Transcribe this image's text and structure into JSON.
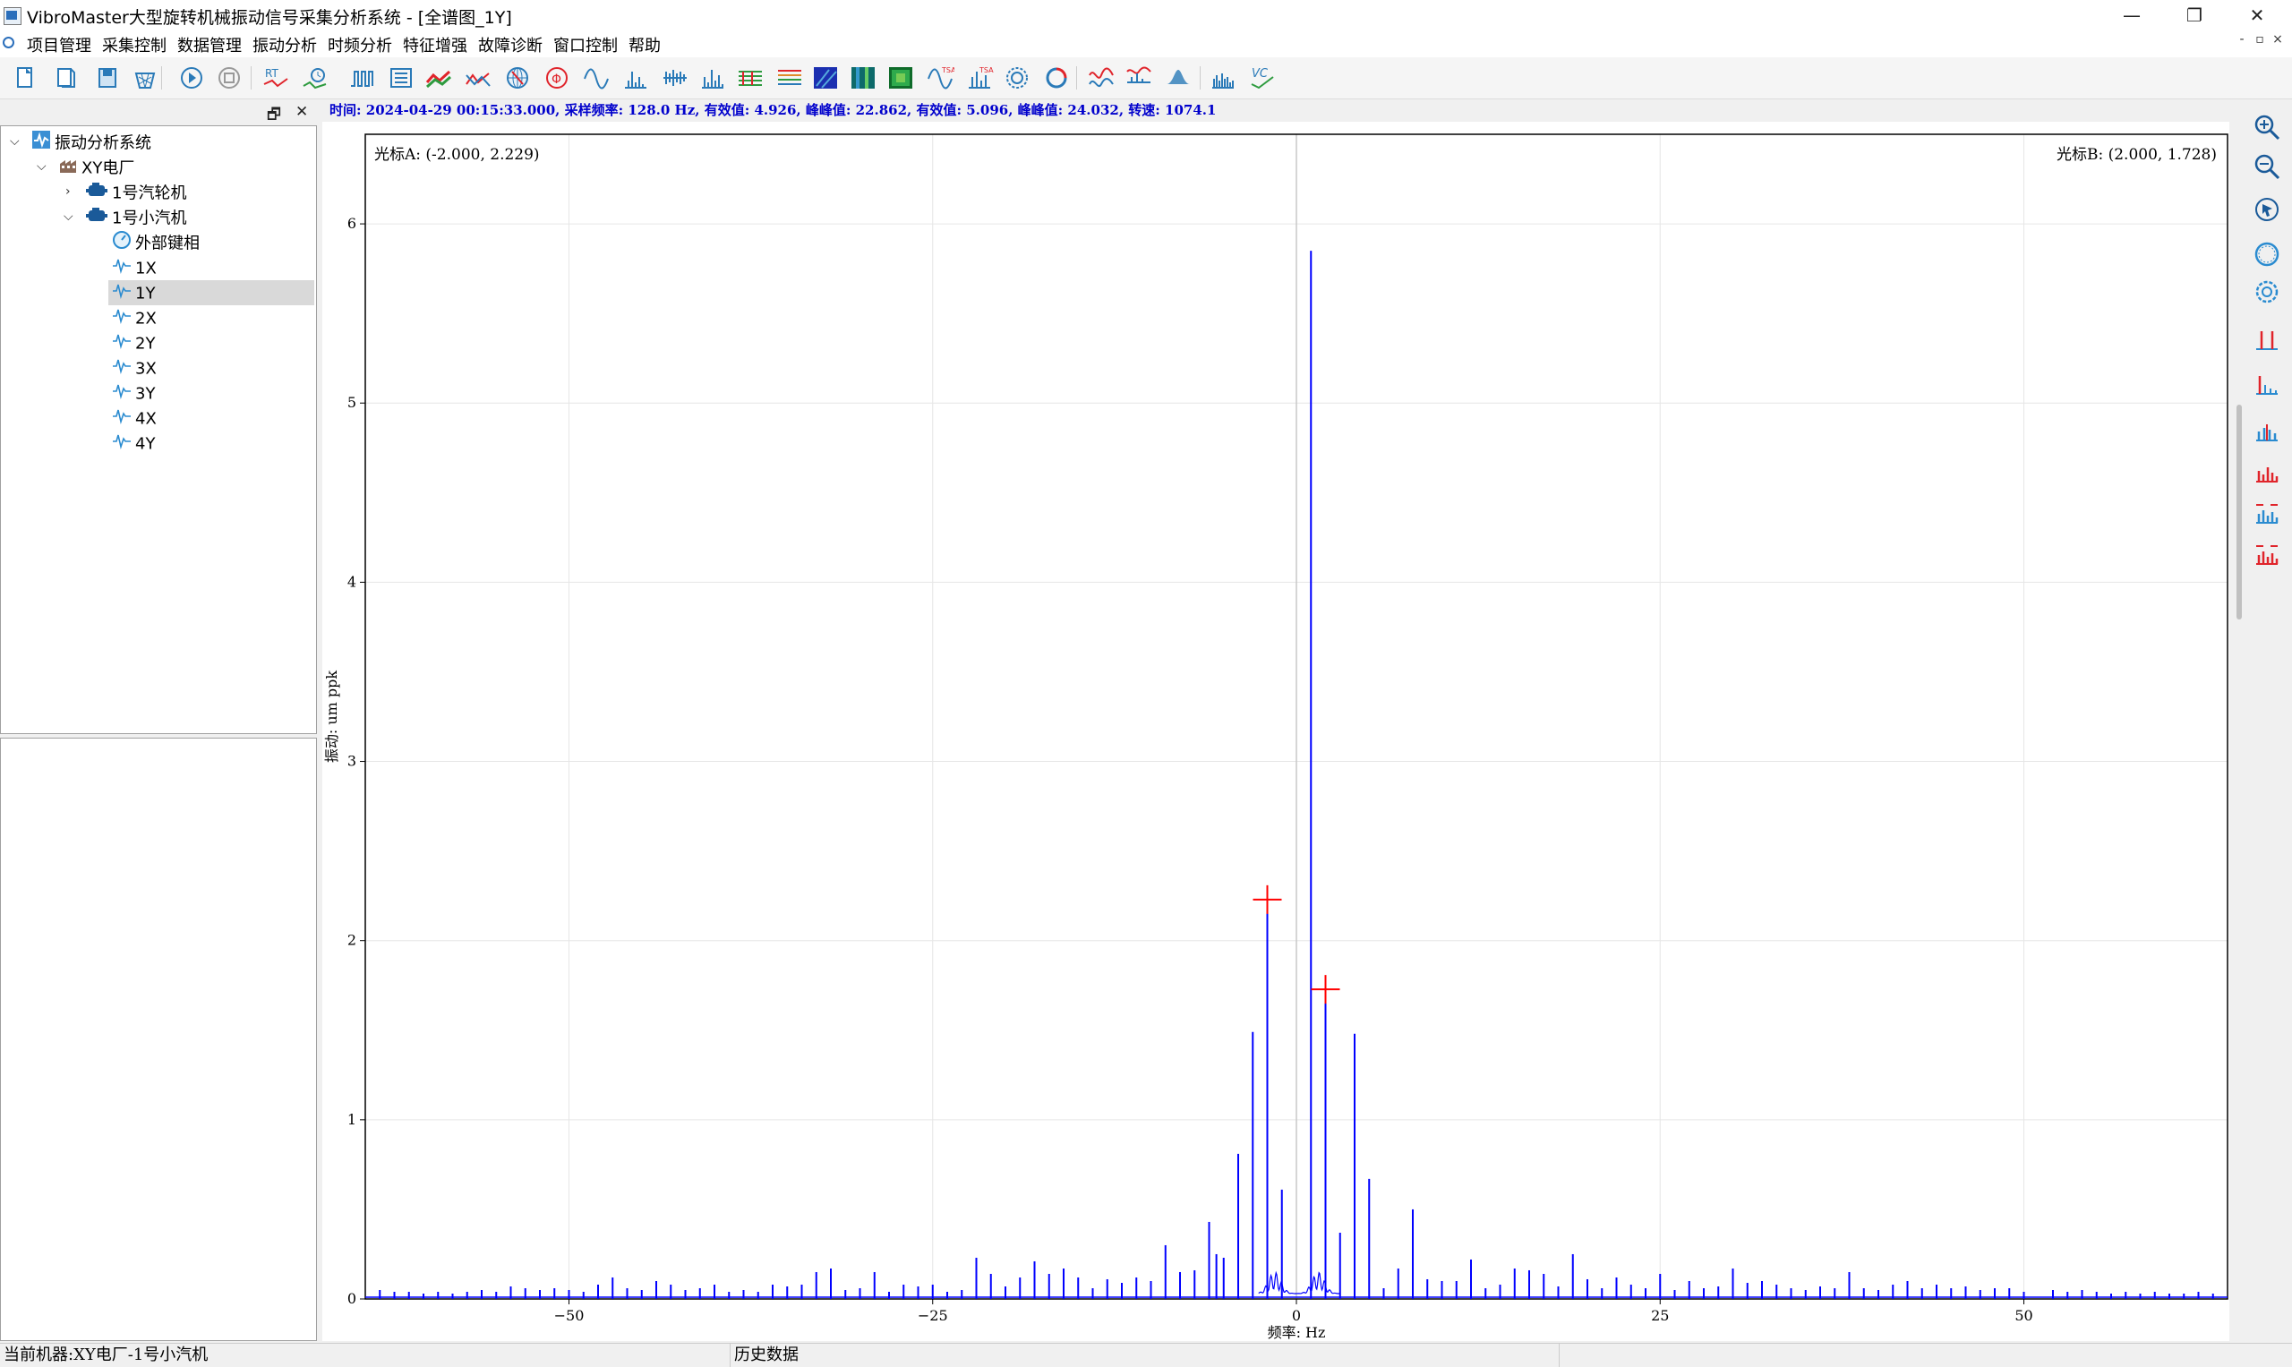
{
  "window": {
    "title": "VibroMaster大型旋转机械振动信号采集分析系统 - [全谱图_1Y]",
    "minimize": "—",
    "restore": "❐",
    "close": "✕"
  },
  "menu": [
    "项目管理",
    "采集控制",
    "数据管理",
    "振动分析",
    "时频分析",
    "特征增强",
    "故障诊断",
    "窗口控制",
    "帮助"
  ],
  "mdi_buttons": [
    "-",
    "▫",
    "×"
  ],
  "toolbar_icons": [
    "new-file-icon",
    "open-file-icon",
    "save-icon",
    "delete-basket-icon",
    "play-icon",
    "stop-icon",
    "realtime-icon",
    "time-wave-icon",
    "pulse-icon",
    "list-icon",
    "trend-icon",
    "trend2-icon",
    "orbit-globe-icon",
    "phase-icon",
    "sine-icon",
    "spectrum-icon",
    "comb-icon",
    "spectrum2-icon",
    "waterfall-icon",
    "cascade-icon",
    "spectrogram-icon",
    "spectrogram2-icon",
    "spectrogram3-icon",
    "wavelet-icon",
    "envelope-icon",
    "polar-icon",
    "circle-orbit-icon",
    "wave-filter-icon",
    "wave-compare-icon",
    "density-icon",
    "bar-spectrum-icon",
    "vc-icon"
  ],
  "panel": {
    "restore": "🗗",
    "close": "✕"
  },
  "tree": {
    "root": "振动分析系统",
    "plant": "XY电厂",
    "machines": [
      {
        "label": "1号汽轮机",
        "expanded": false
      },
      {
        "label": "1号小汽机",
        "expanded": true
      }
    ],
    "channels": [
      "外部键相",
      "1X",
      "1Y",
      "2X",
      "2Y",
      "3X",
      "3Y",
      "4X",
      "4Y"
    ],
    "selected": "1Y"
  },
  "info": {
    "text": "时间: 2024-04-29 00:15:33.000, 采样频率: 128.0 Hz, 有效值: 4.926, 峰峰值: 22.862, 有效值: 5.096, 峰峰值: 24.032, 转速: 1074.1"
  },
  "cursors": {
    "a_label": "光标A: (-2.000, 2.229)",
    "b_label": "光标B: (2.000, 1.728)",
    "a": {
      "x": -2.0,
      "y": 2.229
    },
    "b": {
      "x": 2.0,
      "y": 1.728
    },
    "color": "#ff0000"
  },
  "chart_data": {
    "type": "line",
    "xlabel": "频率: Hz",
    "ylabel": "振动: um ppk",
    "xlim": [
      -64,
      64
    ],
    "ylim": [
      0,
      6.5
    ],
    "xticks": [
      -50,
      -25,
      0,
      25,
      50
    ],
    "yticks": [
      0,
      1,
      2,
      3,
      4,
      5,
      6
    ],
    "grid": true,
    "line_color": "#0000ff",
    "peaks": [
      {
        "x": -63,
        "y": 0.05
      },
      {
        "x": -62,
        "y": 0.04
      },
      {
        "x": -61,
        "y": 0.04
      },
      {
        "x": -60,
        "y": 0.03
      },
      {
        "x": -59,
        "y": 0.04
      },
      {
        "x": -58,
        "y": 0.03
      },
      {
        "x": -57,
        "y": 0.04
      },
      {
        "x": -56,
        "y": 0.05
      },
      {
        "x": -55,
        "y": 0.04
      },
      {
        "x": -54,
        "y": 0.07
      },
      {
        "x": -53,
        "y": 0.06
      },
      {
        "x": -52,
        "y": 0.05
      },
      {
        "x": -51,
        "y": 0.06
      },
      {
        "x": -50,
        "y": 0.05
      },
      {
        "x": -49,
        "y": 0.04
      },
      {
        "x": -48,
        "y": 0.08
      },
      {
        "x": -47,
        "y": 0.12
      },
      {
        "x": -46,
        "y": 0.06
      },
      {
        "x": -45,
        "y": 0.05
      },
      {
        "x": -44,
        "y": 0.1
      },
      {
        "x": -43,
        "y": 0.08
      },
      {
        "x": -42,
        "y": 0.05
      },
      {
        "x": -41,
        "y": 0.06
      },
      {
        "x": -40,
        "y": 0.08
      },
      {
        "x": -39,
        "y": 0.04
      },
      {
        "x": -38,
        "y": 0.05
      },
      {
        "x": -37,
        "y": 0.04
      },
      {
        "x": -36,
        "y": 0.08
      },
      {
        "x": -35,
        "y": 0.07
      },
      {
        "x": -34,
        "y": 0.08
      },
      {
        "x": -33,
        "y": 0.15
      },
      {
        "x": -32,
        "y": 0.17
      },
      {
        "x": -31,
        "y": 0.05
      },
      {
        "x": -30,
        "y": 0.06
      },
      {
        "x": -29,
        "y": 0.15
      },
      {
        "x": -28,
        "y": 0.04
      },
      {
        "x": -27,
        "y": 0.08
      },
      {
        "x": -26,
        "y": 0.07
      },
      {
        "x": -25,
        "y": 0.08
      },
      {
        "x": -24,
        "y": 0.04
      },
      {
        "x": -23,
        "y": 0.05
      },
      {
        "x": -22,
        "y": 0.23
      },
      {
        "x": -21,
        "y": 0.14
      },
      {
        "x": -20,
        "y": 0.07
      },
      {
        "x": -19,
        "y": 0.12
      },
      {
        "x": -18,
        "y": 0.21
      },
      {
        "x": -17,
        "y": 0.14
      },
      {
        "x": -16,
        "y": 0.17
      },
      {
        "x": -15,
        "y": 0.12
      },
      {
        "x": -14,
        "y": 0.06
      },
      {
        "x": -13,
        "y": 0.11
      },
      {
        "x": -12,
        "y": 0.09
      },
      {
        "x": -11,
        "y": 0.12
      },
      {
        "x": -10,
        "y": 0.1
      },
      {
        "x": -9,
        "y": 0.3
      },
      {
        "x": -8,
        "y": 0.15
      },
      {
        "x": -7,
        "y": 0.16
      },
      {
        "x": -6,
        "y": 0.43
      },
      {
        "x": -5.5,
        "y": 0.25
      },
      {
        "x": -5,
        "y": 0.23
      },
      {
        "x": -4,
        "y": 0.81
      },
      {
        "x": -3,
        "y": 1.49
      },
      {
        "x": -2,
        "y": 2.229
      },
      {
        "x": -1,
        "y": 0.61
      },
      {
        "x": 1,
        "y": 5.85
      },
      {
        "x": 2,
        "y": 1.728
      },
      {
        "x": 3,
        "y": 0.37
      },
      {
        "x": 4,
        "y": 1.48
      },
      {
        "x": 5,
        "y": 0.67
      },
      {
        "x": 6,
        "y": 0.06
      },
      {
        "x": 7,
        "y": 0.17
      },
      {
        "x": 8,
        "y": 0.5
      },
      {
        "x": 9,
        "y": 0.11
      },
      {
        "x": 10,
        "y": 0.1
      },
      {
        "x": 11,
        "y": 0.1
      },
      {
        "x": 12,
        "y": 0.22
      },
      {
        "x": 13,
        "y": 0.06
      },
      {
        "x": 14,
        "y": 0.08
      },
      {
        "x": 15,
        "y": 0.17
      },
      {
        "x": 16,
        "y": 0.16
      },
      {
        "x": 17,
        "y": 0.14
      },
      {
        "x": 18,
        "y": 0.07
      },
      {
        "x": 19,
        "y": 0.25
      },
      {
        "x": 20,
        "y": 0.11
      },
      {
        "x": 21,
        "y": 0.06
      },
      {
        "x": 22,
        "y": 0.12
      },
      {
        "x": 23,
        "y": 0.08
      },
      {
        "x": 24,
        "y": 0.06
      },
      {
        "x": 25,
        "y": 0.14
      },
      {
        "x": 26,
        "y": 0.05
      },
      {
        "x": 27,
        "y": 0.1
      },
      {
        "x": 28,
        "y": 0.06
      },
      {
        "x": 29,
        "y": 0.07
      },
      {
        "x": 30,
        "y": 0.17
      },
      {
        "x": 31,
        "y": 0.09
      },
      {
        "x": 32,
        "y": 0.1
      },
      {
        "x": 33,
        "y": 0.08
      },
      {
        "x": 34,
        "y": 0.06
      },
      {
        "x": 35,
        "y": 0.05
      },
      {
        "x": 36,
        "y": 0.07
      },
      {
        "x": 37,
        "y": 0.06
      },
      {
        "x": 38,
        "y": 0.15
      },
      {
        "x": 39,
        "y": 0.06
      },
      {
        "x": 40,
        "y": 0.05
      },
      {
        "x": 41,
        "y": 0.08
      },
      {
        "x": 42,
        "y": 0.1
      },
      {
        "x": 43,
        "y": 0.06
      },
      {
        "x": 44,
        "y": 0.08
      },
      {
        "x": 45,
        "y": 0.06
      },
      {
        "x": 46,
        "y": 0.07
      },
      {
        "x": 47,
        "y": 0.05
      },
      {
        "x": 48,
        "y": 0.06
      },
      {
        "x": 49,
        "y": 0.06
      },
      {
        "x": 50,
        "y": 0.04
      },
      {
        "x": 52,
        "y": 0.05
      },
      {
        "x": 53,
        "y": 0.04
      },
      {
        "x": 54,
        "y": 0.05
      },
      {
        "x": 55,
        "y": 0.04
      },
      {
        "x": 56,
        "y": 0.03
      },
      {
        "x": 57,
        "y": 0.04
      },
      {
        "x": 58,
        "y": 0.03
      },
      {
        "x": 59,
        "y": 0.04
      },
      {
        "x": 60,
        "y": 0.03
      },
      {
        "x": 61,
        "y": 0.03
      },
      {
        "x": 62,
        "y": 0.04
      },
      {
        "x": 63,
        "y": 0.03
      }
    ]
  },
  "right_tools": [
    "zoom-in-icon",
    "zoom-out-icon",
    "pointer-icon",
    "circle-icon",
    "settings-icon",
    "cursor-single-icon",
    "cursor-harmonic-icon",
    "cursor-multi-icon",
    "cursor-sideband-icon",
    "cursor-band-icon",
    "cursor-band2-icon"
  ],
  "status": {
    "machine": "当前机器:XY电厂-1号小汽机",
    "mode": "历史数据"
  }
}
